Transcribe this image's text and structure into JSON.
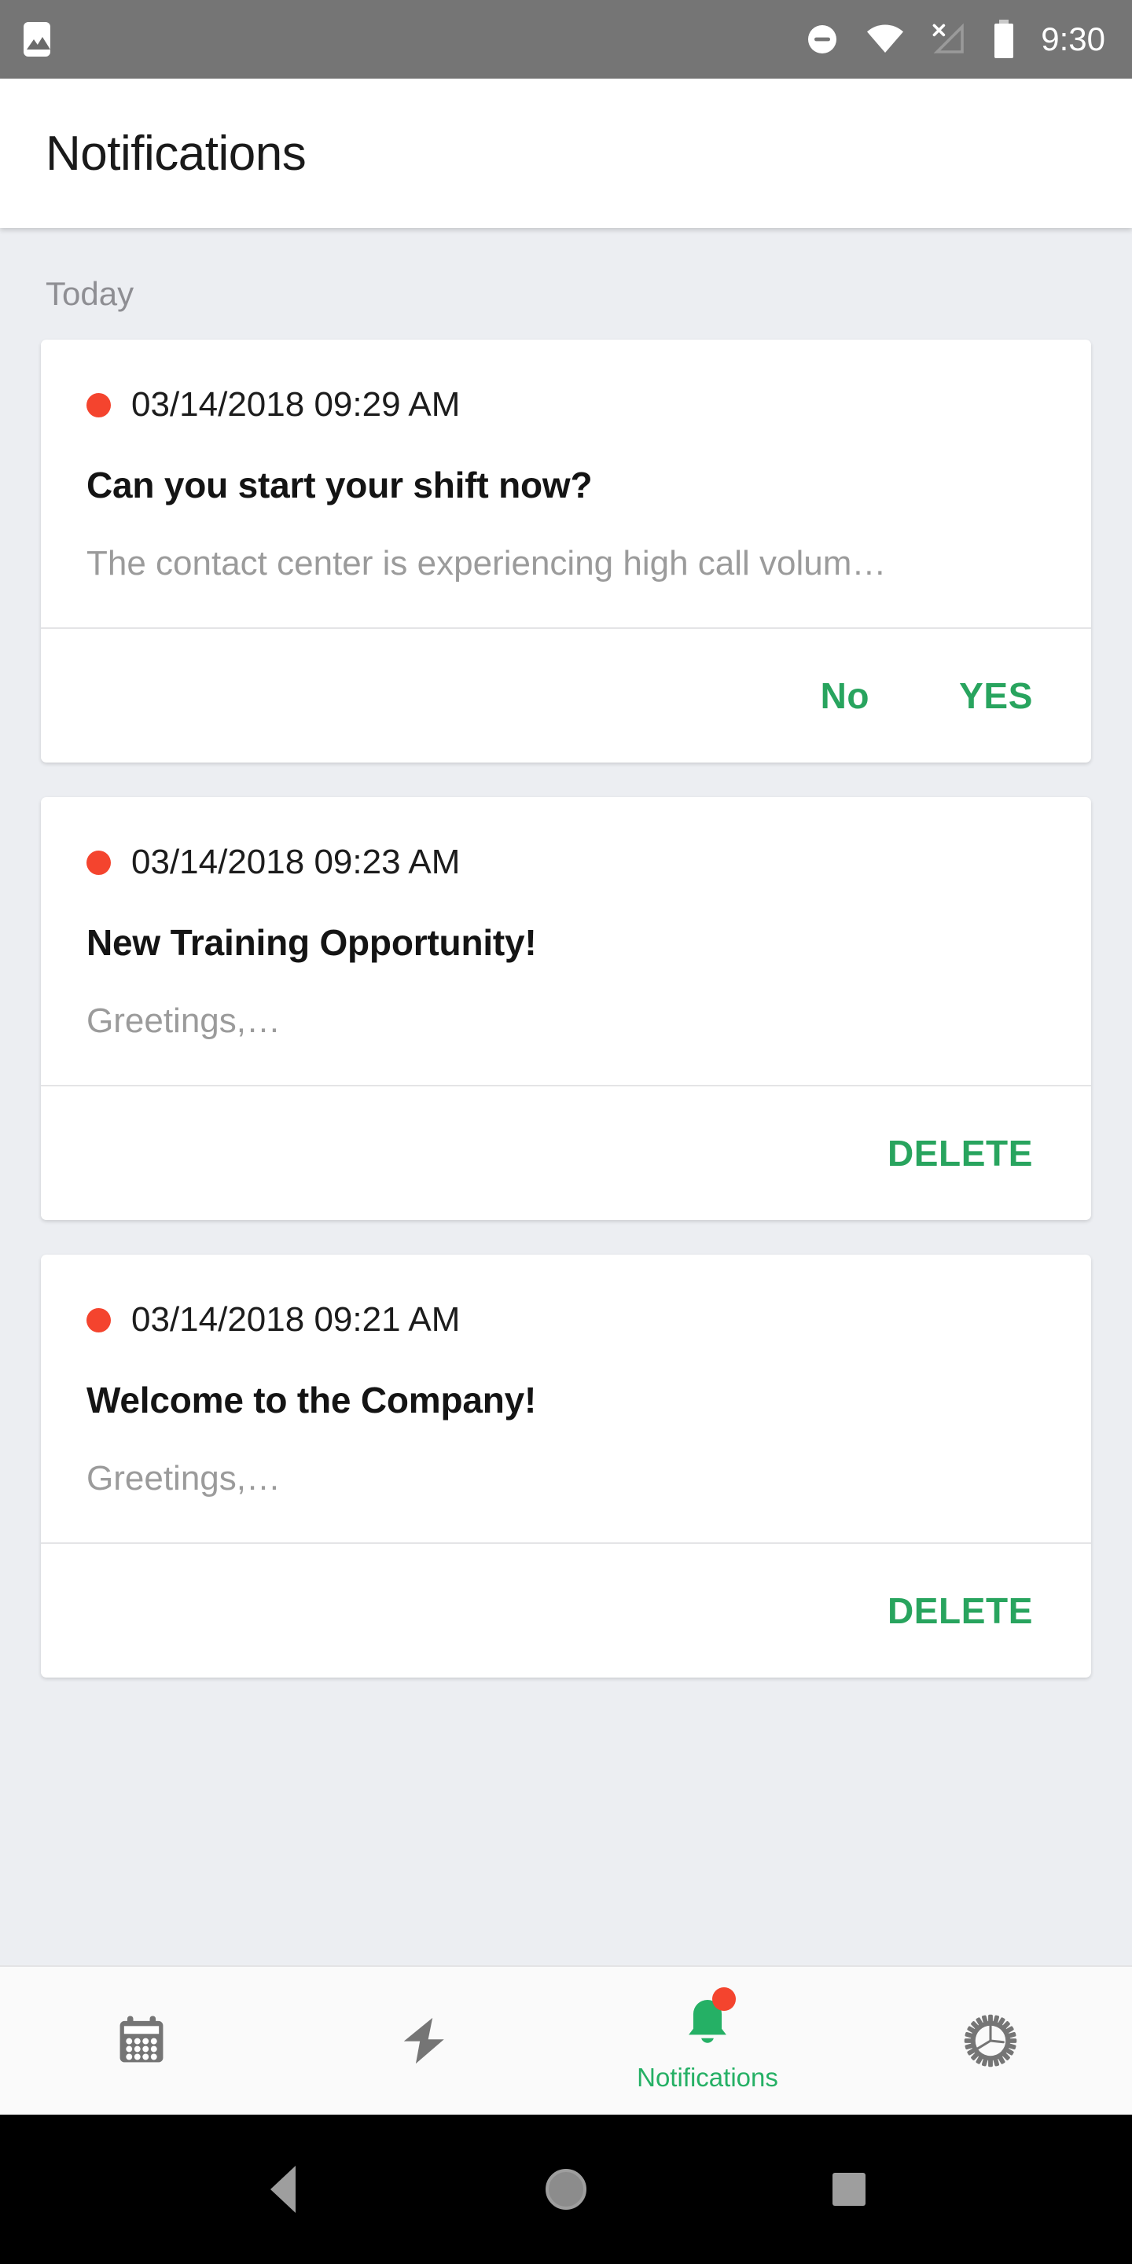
{
  "statusbar": {
    "time": "9:30",
    "icons": [
      {
        "name": "image-notification-icon",
        "glyph": "image"
      },
      {
        "name": "do-not-disturb-icon",
        "glyph": "minus-circle"
      },
      {
        "name": "wifi-icon",
        "glyph": "wifi"
      },
      {
        "name": "no-cellular-signal-icon",
        "glyph": "signal-off"
      },
      {
        "name": "battery-icon",
        "glyph": "battery-full"
      }
    ],
    "background_color": "#757575"
  },
  "appbar": {
    "title": "Notifications"
  },
  "content": {
    "section_label": "Today",
    "background_color": "#eceef2",
    "accent_color": "#28a45e",
    "unread_dot_color": "#f4442e",
    "notifications": [
      {
        "timestamp": "03/14/2018 09:29 AM",
        "title": "Can you start your shift now?",
        "preview": "The contact center is experiencing high call volum…",
        "unread": true,
        "actions": [
          {
            "label": "No",
            "name": "no-button"
          },
          {
            "label": "YES",
            "name": "yes-button"
          }
        ]
      },
      {
        "timestamp": "03/14/2018 09:23 AM",
        "title": "New Training Opportunity!",
        "preview": "Greetings,…",
        "unread": true,
        "actions": [
          {
            "label": "DELETE",
            "name": "delete-button"
          }
        ]
      },
      {
        "timestamp": "03/14/2018 09:21 AM",
        "title": "Welcome to the Company!",
        "preview": "Greetings,…",
        "unread": true,
        "actions": [
          {
            "label": "DELETE",
            "name": "delete-button"
          }
        ]
      }
    ]
  },
  "bottomnav": {
    "items": [
      {
        "icon": "calendar-icon",
        "label": "",
        "active": false
      },
      {
        "icon": "lightning-bolt-icon",
        "label": "",
        "active": false
      },
      {
        "icon": "bell-icon",
        "label": "Notifications",
        "active": true,
        "badge": true
      },
      {
        "icon": "gear-icon",
        "label": "",
        "active": false
      }
    ],
    "active_color": "#25b065",
    "inactive_color": "#757575"
  },
  "sysnav": {
    "buttons": [
      {
        "name": "back-icon"
      },
      {
        "name": "home-icon"
      },
      {
        "name": "recents-icon"
      }
    ]
  }
}
